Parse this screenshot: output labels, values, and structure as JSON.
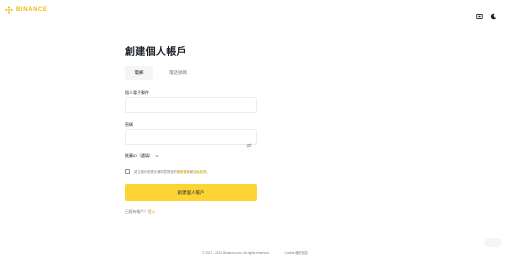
{
  "brand": {
    "name": "BINANCE",
    "accent": "#F0B90B"
  },
  "header": {
    "icons": [
      "download-icon",
      "theme-toggle-icon"
    ]
  },
  "form": {
    "title": "創建個人帳戶",
    "tabs": [
      {
        "label": "電郵",
        "active": true
      },
      {
        "label": "電話號碼",
        "active": false
      }
    ],
    "email": {
      "label": "個人電子郵件",
      "value": "",
      "placeholder": ""
    },
    "password": {
      "label": "密碼",
      "value": "",
      "placeholder": ""
    },
    "referral": {
      "label": "推薦ID（選填）"
    },
    "agreement": {
      "prefix": "創立帳戶即表示我同意幣安的",
      "terms_link": "服務條款",
      "conjunction": "和",
      "privacy_link": "隱私政策",
      "suffix": "。"
    },
    "submit_label": "創建個人帳戶",
    "login_prompt": "已經有帳戶？",
    "login_link": "登入"
  },
  "footer": {
    "copyright": "© 2017 - 2021 Binance.com. All rights reserved",
    "cookie_link": "Cookie 偏好設定"
  }
}
